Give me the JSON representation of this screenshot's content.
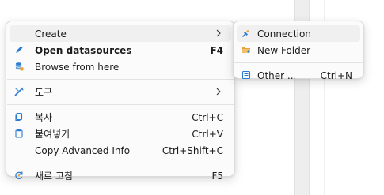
{
  "context_menu": {
    "items": [
      {
        "label": "Create",
        "icon": "none",
        "submenu": true
      },
      {
        "label": "Open datasources",
        "icon": "pencil-icon",
        "shortcut": "F4",
        "bold": true
      },
      {
        "label": "Browse from here",
        "icon": "database-icon"
      },
      {
        "label": "도구",
        "icon": "tools-icon",
        "submenu": true
      },
      {
        "label": "복사",
        "icon": "copy-icon",
        "shortcut": "Ctrl+C"
      },
      {
        "label": "붙여넣기",
        "icon": "paste-icon",
        "shortcut": "Ctrl+V"
      },
      {
        "label": "Copy Advanced Info",
        "icon": "none",
        "shortcut": "Ctrl+Shift+C"
      },
      {
        "label": "새로 고침",
        "icon": "refresh-icon",
        "shortcut": "F5"
      }
    ]
  },
  "create_submenu": {
    "items": [
      {
        "label": "Connection",
        "icon": "new-connection-icon"
      },
      {
        "label": "New Folder",
        "icon": "new-folder-icon"
      },
      {
        "label": "Other ...",
        "icon": "other-icon",
        "shortcut": "Ctrl+N"
      }
    ]
  },
  "colors": {
    "menu_bg": "#fbfbfb",
    "highlight": "#f0f0f0",
    "separator": "#e3e3e3",
    "icon_blue": "#2b7bd0",
    "folder_orange": "#e8a23a"
  }
}
